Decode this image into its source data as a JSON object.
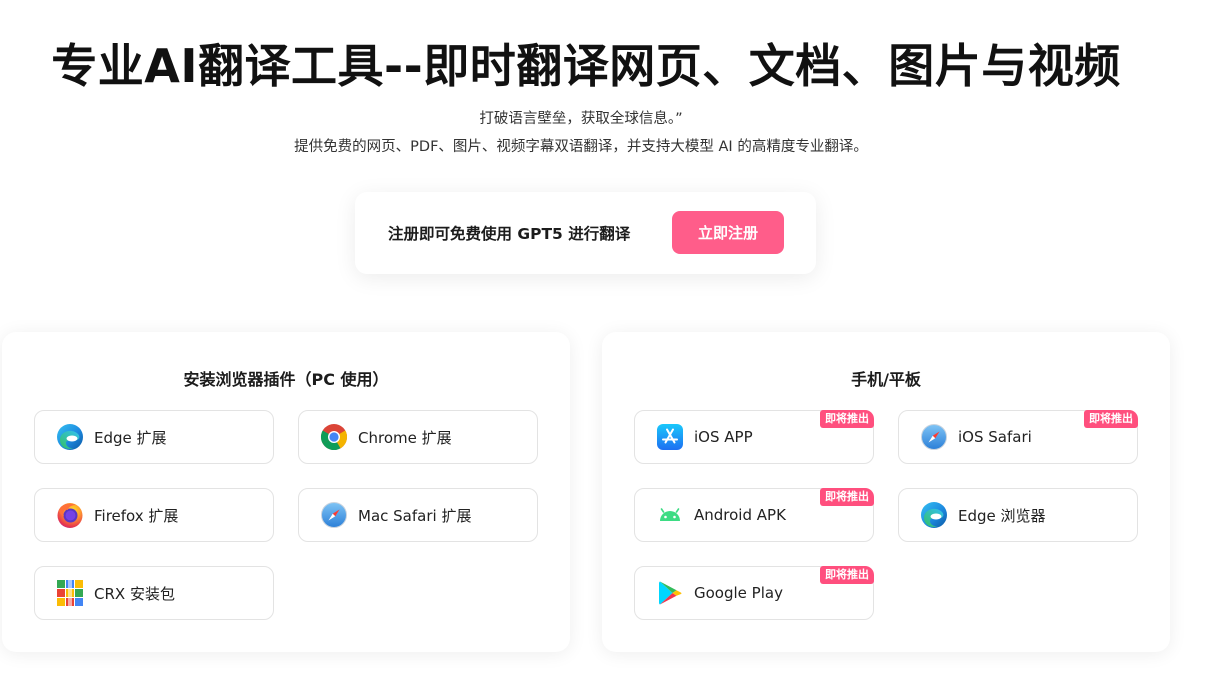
{
  "hero": {
    "title": "专业AI翻译工具--即时翻译网页、文档、图片与视频",
    "subtitle_line1": "打破语言壁垒，获取全球信息。”",
    "subtitle_line2": "提供免费的网页、PDF、图片、视频字幕双语翻译，并支持大模型 AI 的高精度专业翻译。"
  },
  "signup": {
    "text": "注册即可免费使用 GPT5 进行翻译",
    "button_label": "立即注册",
    "accent_color": "#ff5d8a"
  },
  "browser_panel": {
    "title": "安装浏览器插件（PC 使用）",
    "items": [
      {
        "label": "Edge 扩展",
        "icon": "edge-icon"
      },
      {
        "label": "Chrome 扩展",
        "icon": "chrome-icon"
      },
      {
        "label": "Firefox 扩展",
        "icon": "firefox-icon"
      },
      {
        "label": "Mac Safari 扩展",
        "icon": "safari-icon"
      },
      {
        "label": "CRX 安装包",
        "icon": "crx-package-icon"
      }
    ]
  },
  "mobile_panel": {
    "title": "手机/平板",
    "items": [
      {
        "label": "iOS APP",
        "icon": "app-store-icon",
        "badge": "即将推出"
      },
      {
        "label": "iOS Safari",
        "icon": "safari-icon",
        "badge": "即将推出"
      },
      {
        "label": "Android APK",
        "icon": "android-icon",
        "badge": "即将推出"
      },
      {
        "label": "Edge 浏览器",
        "icon": "edge-icon"
      },
      {
        "label": "Google Play",
        "icon": "google-play-icon",
        "badge": "即将推出"
      }
    ],
    "badge_color": "#ff4f7e"
  }
}
